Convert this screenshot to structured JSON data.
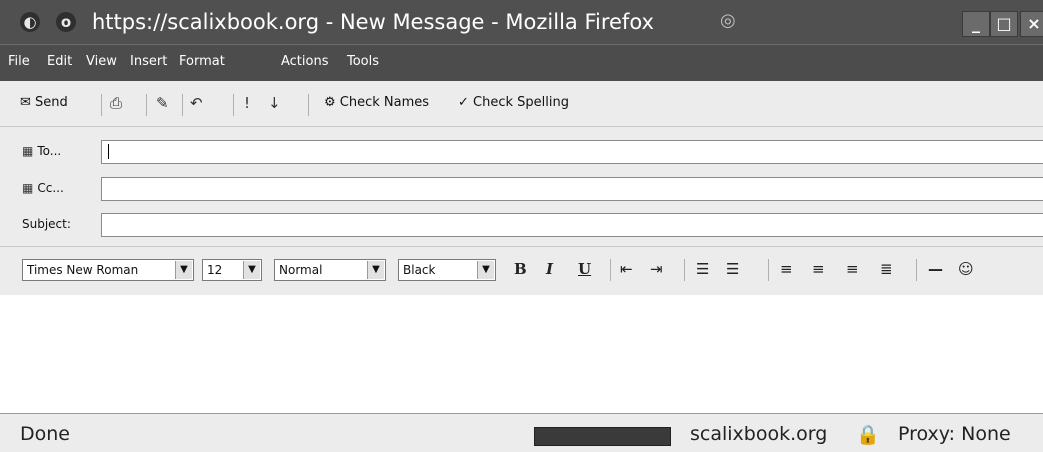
{
  "window": {
    "title": "https://scalixbook.org - New Message - Mozilla Firefox",
    "minimize": "_",
    "maximize": "□",
    "close": "×"
  },
  "menu": [
    "File",
    "Edit",
    "View",
    "Insert",
    "Format",
    "Actions",
    "Tools"
  ],
  "toolbar": {
    "send": "Send",
    "check_names": "Check Names",
    "check_spelling": "Check Spelling"
  },
  "header": {
    "to_label": "To...",
    "cc_label": "Cc...",
    "subject_label": "Subject:",
    "to_value": "",
    "cc_value": "",
    "subject_value": ""
  },
  "format": {
    "font": "Times New Roman",
    "size": "12",
    "style": "Normal",
    "color": "Black",
    "bold": "B",
    "italic": "I",
    "underline": "U"
  },
  "status": {
    "text": "Done",
    "domain": "scalixbook.org",
    "proxy": "Proxy: None"
  }
}
